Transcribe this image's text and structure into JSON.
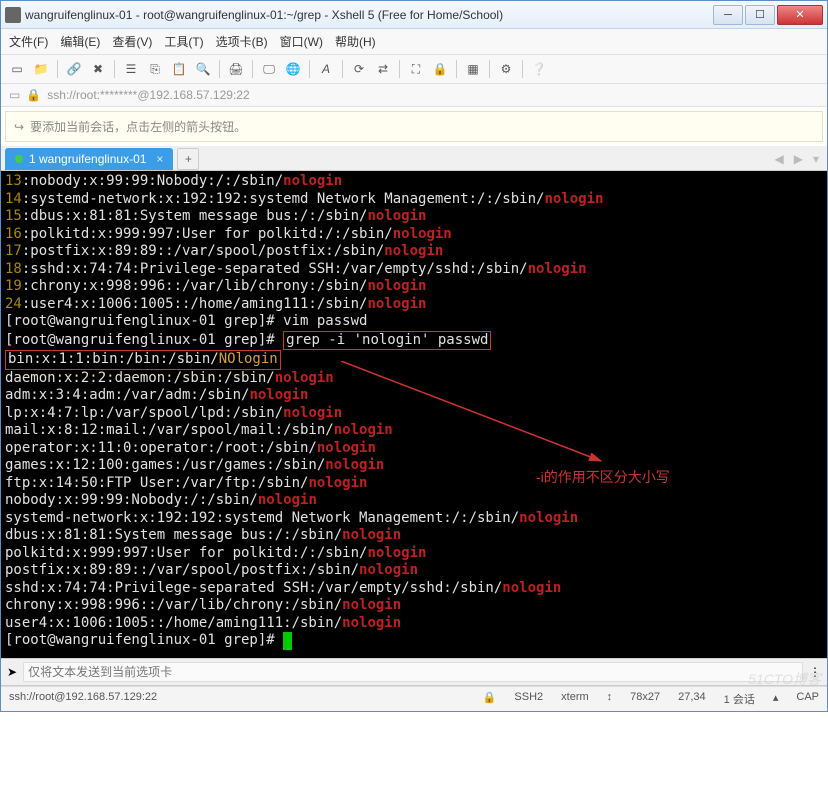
{
  "titlebar": {
    "text": "wangruifenglinux-01 - root@wangruifenglinux-01:~/grep - Xshell 5 (Free for Home/School)"
  },
  "menubar": {
    "items": [
      "文件(F)",
      "编辑(E)",
      "查看(V)",
      "工具(T)",
      "选项卡(B)",
      "窗口(W)",
      "帮助(H)"
    ]
  },
  "addressbar": {
    "text": "ssh://root:********@192.168.57.129:22"
  },
  "sessionbar": {
    "text": "要添加当前会话，点击左侧的箭头按钮。"
  },
  "tab": {
    "label": "1 wangruifenglinux-01"
  },
  "annotation": {
    "text": "-i的作用不区分大小写"
  },
  "terminal": {
    "lines": [
      {
        "n": "13",
        "pre": ":nobody:x:99:99:Nobody:/:/sbin/",
        "hl": "nologin"
      },
      {
        "n": "14",
        "pre": ":systemd-network:x:192:192:systemd Network Management:/:/sbin/",
        "hl": "nologin"
      },
      {
        "n": "15",
        "pre": ":dbus:x:81:81:System message bus:/:/sbin/",
        "hl": "nologin"
      },
      {
        "n": "16",
        "pre": ":polkitd:x:999:997:User for polkitd:/:/sbin/",
        "hl": "nologin"
      },
      {
        "n": "17",
        "pre": ":postfix:x:89:89::/var/spool/postfix:/sbin/",
        "hl": "nologin"
      },
      {
        "n": "18",
        "pre": ":sshd:x:74:74:Privilege-separated SSH:/var/empty/sshd:/sbin/",
        "hl": "nologin"
      },
      {
        "n": "19",
        "pre": ":chrony:x:998:996::/var/lib/chrony:/sbin/",
        "hl": "nologin"
      },
      {
        "n": "24",
        "pre": ":user4:x:1006:1005::/home/aming111:/sbin/",
        "hl": "nologin"
      }
    ],
    "prompt1": "[root@wangruifenglinux-01 grep]# ",
    "cmd1": "vim passwd",
    "prompt2": "[root@wangruifenglinux-01 grep]# ",
    "cmd2": "grep -i 'nologin' passwd",
    "box_pre": "bin:x:1:1:bin:/bin:/sbin/",
    "box_hl": "NOlogin",
    "plainlines": [
      {
        "pre": "daemon:x:2:2:daemon:/sbin:/sbin/",
        "hl": "nologin"
      },
      {
        "pre": "adm:x:3:4:adm:/var/adm:/sbin/",
        "hl": "nologin"
      },
      {
        "pre": "lp:x:4:7:lp:/var/spool/lpd:/sbin/",
        "hl": "nologin"
      },
      {
        "pre": "mail:x:8:12:mail:/var/spool/mail:/sbin/",
        "hl": "nologin"
      },
      {
        "pre": "operator:x:11:0:operator:/root:/sbin/",
        "hl": "nologin"
      },
      {
        "pre": "games:x:12:100:games:/usr/games:/sbin/",
        "hl": "nologin"
      },
      {
        "pre": "ftp:x:14:50:FTP User:/var/ftp:/sbin/",
        "hl": "nologin"
      },
      {
        "pre": "nobody:x:99:99:Nobody:/:/sbin/",
        "hl": "nologin"
      },
      {
        "pre": "systemd-network:x:192:192:systemd Network Management:/:/sbin/",
        "hl": "nologin"
      },
      {
        "pre": "dbus:x:81:81:System message bus:/:/sbin/",
        "hl": "nologin"
      },
      {
        "pre": "polkitd:x:999:997:User for polkitd:/:/sbin/",
        "hl": "nologin"
      },
      {
        "pre": "postfix:x:89:89::/var/spool/postfix:/sbin/",
        "hl": "nologin"
      },
      {
        "pre": "sshd:x:74:74:Privilege-separated SSH:/var/empty/sshd:/sbin/",
        "hl": "nologin"
      },
      {
        "pre": "chrony:x:998:996::/var/lib/chrony:/sbin/",
        "hl": "nologin"
      },
      {
        "pre": "user4:x:1006:1005::/home/aming111:/sbin/",
        "hl": "nologin"
      }
    ],
    "prompt3": "[root@wangruifenglinux-01 grep]# "
  },
  "inputbar": {
    "placeholder": "仅将文本发送到当前选项卡"
  },
  "statusbar": {
    "left": "ssh://root@192.168.57.129:22",
    "ssh": "SSH2",
    "term": "xterm",
    "size": "78x27",
    "pos": "27,34",
    "sessions": "1 会话",
    "cap": "CAP"
  },
  "watermark": "51CTO博客"
}
